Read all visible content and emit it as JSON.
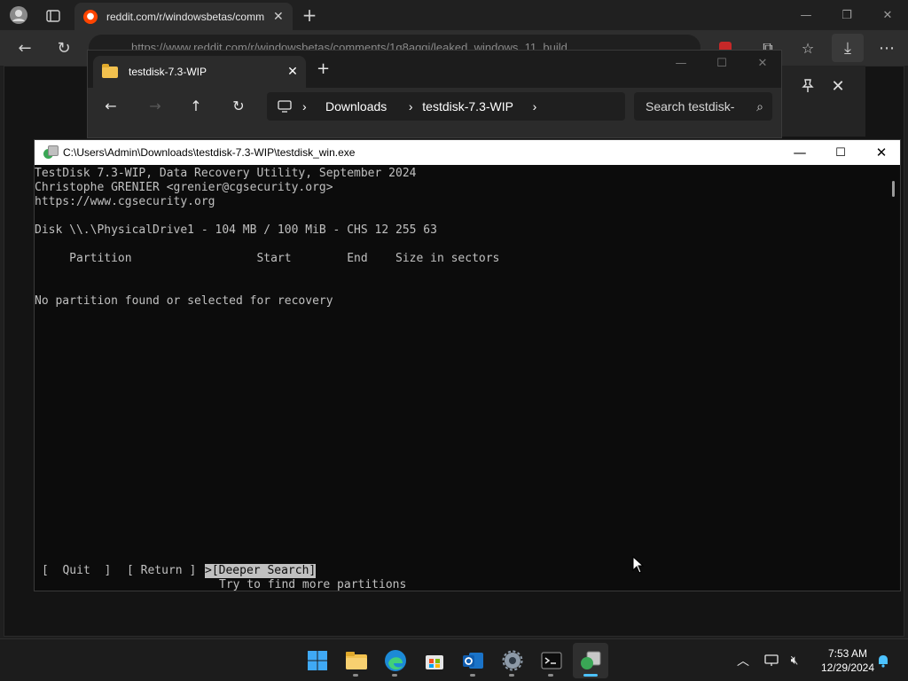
{
  "browser": {
    "tab_title": "reddit.com/r/windowsbetas/comm",
    "tab_favicon": "reddit-icon",
    "address": "https://www.reddit.com/r/windowsbetas/comments/1g8aggj/leaked_windows_11_build..."
  },
  "explorer": {
    "tab_title": "testdisk-7.3-WIP",
    "breadcrumb": [
      "Downloads",
      "testdisk-7.3-WIP"
    ],
    "search_placeholder": "Search testdisk-"
  },
  "console": {
    "title": "C:\\Users\\Admin\\Downloads\\testdisk-7.3-WIP\\testdisk_win.exe",
    "lines": {
      "l1": "TestDisk 7.3-WIP, Data Recovery Utility, September 2024",
      "l2": "Christophe GRENIER <grenier@cgsecurity.org>",
      "l3": "https://www.cgsecurity.org",
      "l4": "Disk \\\\.\\PhysicalDrive1 - 104 MB / 100 MiB - CHS 12 255 63",
      "l5": "     Partition                  Start        End    Size in sectors",
      "l6": "No partition found or selected for recovery"
    },
    "menu": {
      "quit": "[  Quit  ]",
      "ret": "[ Return ]",
      "deeper": ">[Deeper Search]"
    },
    "hint": "Try to find more partitions"
  },
  "taskbar": {
    "apps": [
      "start",
      "file-explorer",
      "edge",
      "microsoft-store",
      "outlook",
      "settings",
      "terminal",
      "testdisk"
    ],
    "time": "7:53 AM",
    "date": "12/29/2024"
  },
  "colors": {
    "console_bg": "#0c0c0c",
    "console_text": "#c0c0c0",
    "accent": "#4cc2ff"
  }
}
